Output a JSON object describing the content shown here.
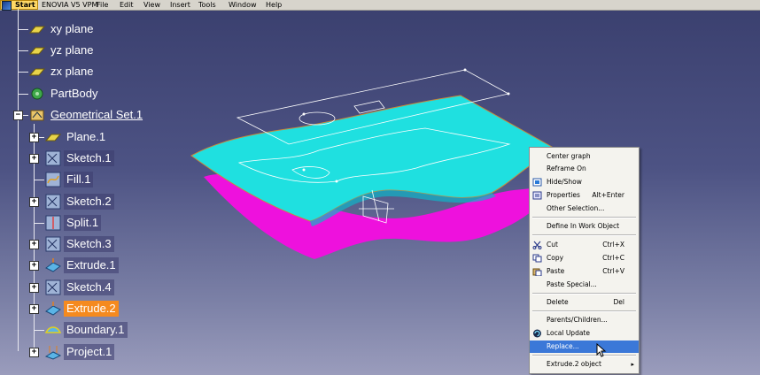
{
  "menubar": {
    "start": "Start",
    "app": "ENOVIA V5 VPM",
    "file": "File",
    "edit": "Edit",
    "view": "View",
    "insert": "Insert",
    "tools": "Tools",
    "window": "Window",
    "help": "Help"
  },
  "tree": {
    "xy_plane": "xy plane",
    "yz_plane": "yz plane",
    "zx_plane": "zx plane",
    "partbody": "PartBody",
    "geoset": "Geometrical Set.1",
    "plane1": "Plane.1",
    "sketch1": "Sketch.1",
    "fill1": "Fill.1",
    "sketch2": "Sketch.2",
    "split1": "Split.1",
    "sketch3": "Sketch.3",
    "extrude1": "Extrude.1",
    "sketch4": "Sketch.4",
    "extrude2": "Extrude.2",
    "boundary1": "Boundary.1",
    "project1": "Project.1"
  },
  "context_menu": {
    "center_graph": "Center graph",
    "reframe_on": "Reframe On",
    "hide_show": "Hide/Show",
    "properties": "Properties",
    "properties_key": "Alt+Enter",
    "other_selection": "Other Selection...",
    "define_in_work": "Define In Work Object",
    "cut": "Cut",
    "cut_key": "Ctrl+X",
    "copy": "Copy",
    "copy_key": "Ctrl+C",
    "paste": "Paste",
    "paste_key": "Ctrl+V",
    "paste_special": "Paste Special...",
    "delete": "Delete",
    "delete_key": "Del",
    "parents_children": "Parents/Children...",
    "local_update": "Local Update",
    "replace": "Replace...",
    "object_submenu": "Extrude.2 object"
  },
  "colors": {
    "upper_surface": "#1fe0e0",
    "lower_surface": "#ee11dd",
    "selection": "#f58a1f",
    "menu_highlight": "#3b78d8"
  }
}
